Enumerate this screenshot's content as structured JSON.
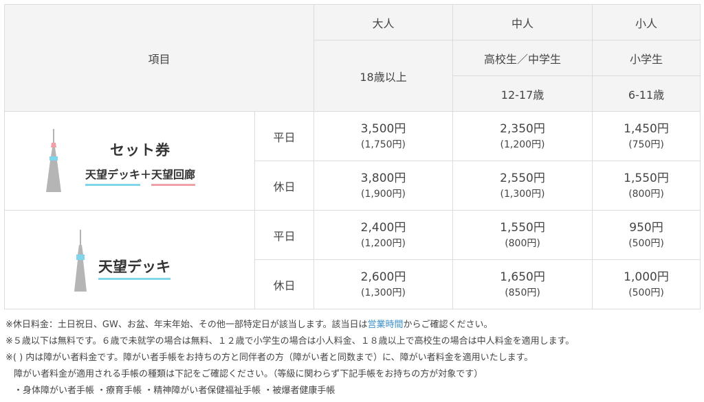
{
  "header": {
    "item": "項目",
    "adult": "大人",
    "middle": "中人",
    "child": "小人",
    "middle_sub": "高校生／中学生",
    "child_sub": "小学生",
    "adult_age": "18歳以上",
    "middle_age": "12-17歳",
    "child_age": "6-11歳"
  },
  "set_ticket": {
    "title": "セット券",
    "deck": "天望デッキ",
    "plus": "＋",
    "gallery": "天望回廊",
    "rows": [
      {
        "day": "平日",
        "adult": "3,500円",
        "adult_d": "(1,750円)",
        "middle": "2,350円",
        "middle_d": "(1,200円)",
        "child": "1,450円",
        "child_d": "(750円)"
      },
      {
        "day": "休日",
        "adult": "3,800円",
        "adult_d": "(1,900円)",
        "middle": "2,550円",
        "middle_d": "(1,300円)",
        "child": "1,550円",
        "child_d": "(800円)"
      }
    ]
  },
  "deck_ticket": {
    "title": "天望デッキ",
    "rows": [
      {
        "day": "平日",
        "adult": "2,400円",
        "adult_d": "(1,200円)",
        "middle": "1,550円",
        "middle_d": "(800円)",
        "child": "950円",
        "child_d": "(500円)"
      },
      {
        "day": "休日",
        "adult": "2,600円",
        "adult_d": "(1,300円)",
        "middle": "1,650円",
        "middle_d": "(850円)",
        "child": "1,000円",
        "child_d": "(500円)"
      }
    ]
  },
  "notes": {
    "line1_a": "※休日料金：土日祝日、GW、お盆、年末年始、その他一部特定日が該当します。該当日は",
    "line1_link": "営業時間",
    "line1_b": "からご確認ください。",
    "line2": "※５歳以下は無料です。６歳で未就学の場合は無料、１２歳で小学生の場合は小人料金、１８歳以上で高校生の場合は中人料金を適用します。",
    "line3": "※( ) 内は障がい者料金です。障がい者手帳をお持ちの方と同伴者の方（障がい者と同数まで）に、障がい者料金を適用いたします。",
    "line4": "障がい者料金が適用される手帳の種類は下記をご確認ください。（等級に関わらず下記手帳をお持ちの方が対象です）",
    "line5": "・身体障がい者手帳 ・療育手帳 ・精神障がい者保健福祉手帳 ・被爆者健康手帳"
  },
  "colors": {
    "border": "#dcdcdc",
    "header_bg": "#f4f4f4",
    "accent_blue": "#7fd6ea",
    "accent_pink": "#f2a0a8",
    "link": "#3a8fc8"
  }
}
